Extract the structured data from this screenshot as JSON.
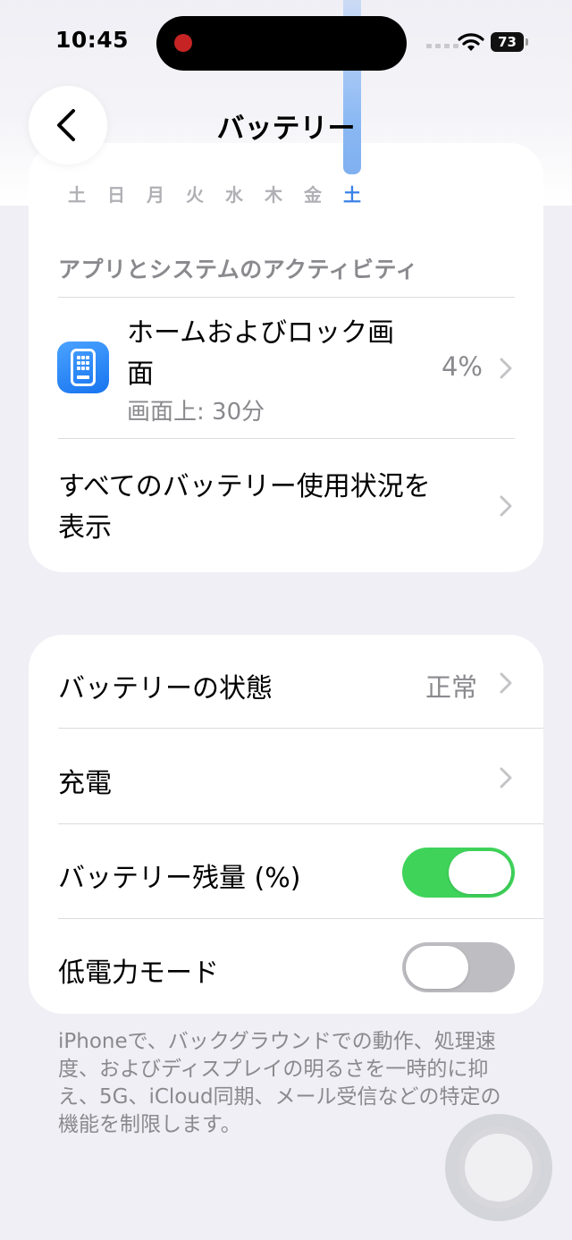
{
  "status_bar": {
    "time": "10:45",
    "battery_level": "73",
    "icons": [
      "wifi-icon",
      "cellular-signal-icon",
      "battery-icon"
    ]
  },
  "header": {
    "title": "バッテリー",
    "back_icon": "chevron-left-icon"
  },
  "chart": {
    "days": [
      "土",
      "日",
      "月",
      "火",
      "水",
      "木",
      "金",
      "土"
    ],
    "active_day_index": 7,
    "accent": "#3b82e6"
  },
  "activity": {
    "header": "アプリとシステムのアクティビティ",
    "app": {
      "name": "ホームおよびロック画面",
      "sub": "画面上: 30分",
      "percent": "4%",
      "icon": "home-lock-screen-icon"
    },
    "all_usage": "すべてのバッテリー使用状況を表示"
  },
  "settings": {
    "battery_health": {
      "label": "バッテリーの状態",
      "value": "正常"
    },
    "charging": {
      "label": "充電"
    },
    "battery_percentage": {
      "label": "バッテリー残量 (%)",
      "on": true
    },
    "low_power": {
      "label": "低電力モード",
      "on": false
    },
    "toggle_on_color": "#3fd35a"
  },
  "footer_note": "iPhoneで、バックグラウンドでの動作、処理速度、およびディスプレイの明るさを一時的に抑え、5G、iCloud同期、メール受信などの特定の機能を制限します。"
}
